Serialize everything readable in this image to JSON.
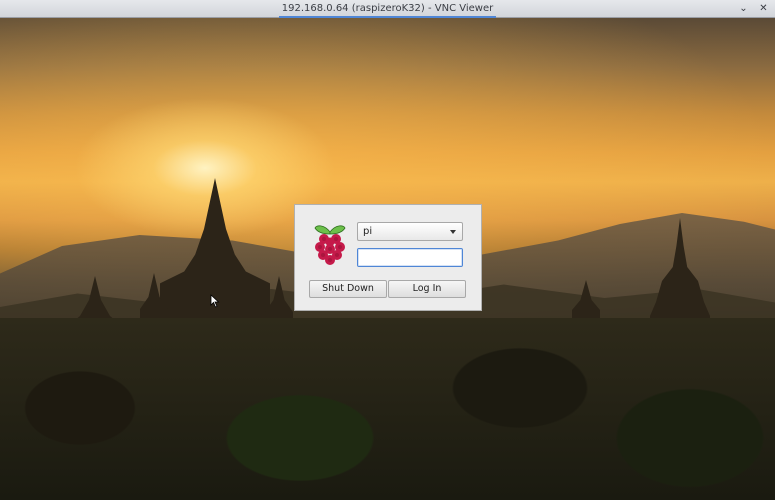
{
  "window": {
    "title": "192.168.0.64 (raspizeroK32) - VNC Viewer",
    "minimize_glyph": "⌄",
    "close_glyph": "✕"
  },
  "login": {
    "username": "pi",
    "password_value": "",
    "shutdown_label": "Shut Down",
    "login_label": "Log In"
  },
  "colors": {
    "accent": "#4f86d6",
    "raspberry_red": "#c51a4a",
    "leaf_green": "#6cc04a"
  },
  "icons": [
    "raspberry-pi-logo-icon",
    "dropdown-arrow-icon",
    "minimize-icon",
    "close-icon",
    "mouse-cursor-icon"
  ]
}
